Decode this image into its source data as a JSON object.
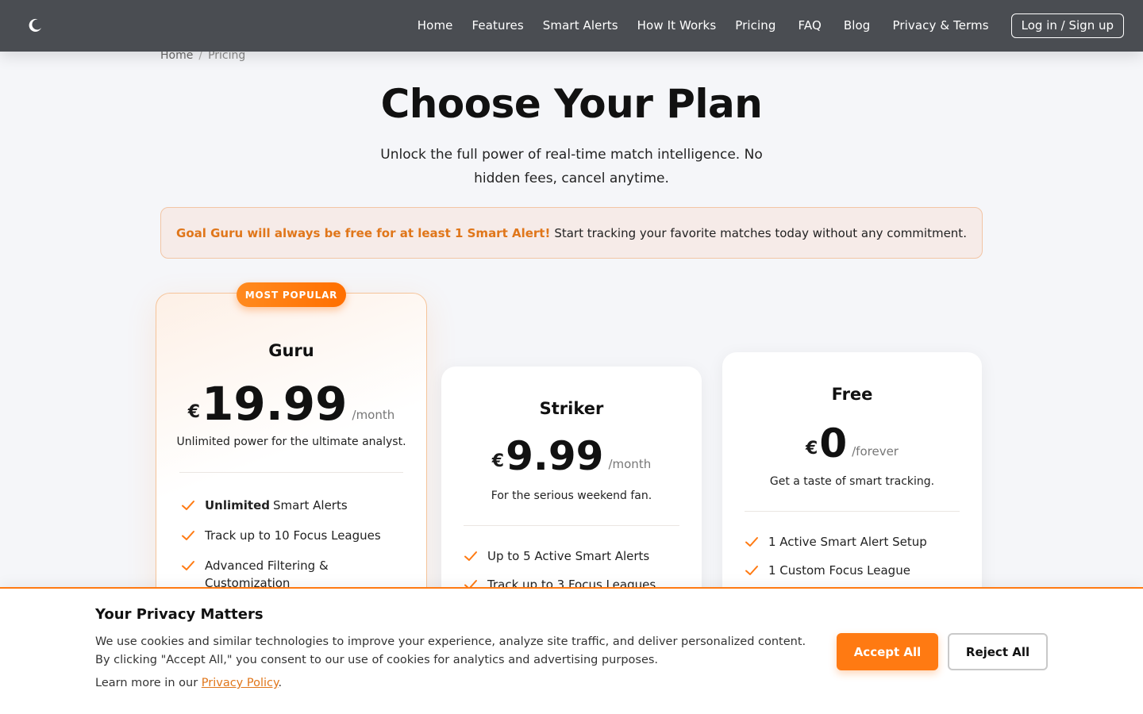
{
  "header": {
    "theme_icon": "moon-icon",
    "nav": [
      "Home",
      "Features",
      "Smart Alerts",
      "How It Works",
      "Pricing",
      "FAQ",
      "Blog",
      "Privacy & Terms"
    ],
    "login_label": "Log in / Sign up"
  },
  "breadcrumb": {
    "home": "Home",
    "separator": "/",
    "current": "Pricing"
  },
  "hero": {
    "title": "Choose Your Plan",
    "subtitle": "Unlock the full power of real-time match intelligence. No hidden fees, cancel anytime."
  },
  "banner": {
    "highlight": "Goal Guru will always be free for at least 1 Smart Alert!",
    "text": "Start tracking your favorite matches today without any commitment."
  },
  "plans": [
    {
      "badge": "MOST POPULAR",
      "name": "Guru",
      "currency": "€",
      "price": "19.99",
      "period": "/month",
      "description": "Unlimited power for the ultimate analyst.",
      "features": [
        {
          "bold": "Unlimited",
          "text": "Smart Alerts"
        },
        {
          "bold": "",
          "text": "Track up to 10 Focus Leagues"
        },
        {
          "bold": "",
          "text": "Advanced Filtering & Customization"
        }
      ]
    },
    {
      "name": "Striker",
      "currency": "€",
      "price": "9.99",
      "period": "/month",
      "description": "For the serious weekend fan.",
      "features": [
        {
          "bold": "",
          "text": "Up to 5 Active Smart Alerts"
        },
        {
          "bold": "",
          "text": "Track up to 3 Focus Leagues"
        }
      ]
    },
    {
      "name": "Free",
      "currency": "€",
      "price": "0",
      "period": "/forever",
      "description": "Get a taste of smart tracking.",
      "features": [
        {
          "bold": "",
          "text": "1 Active Smart Alert Setup"
        },
        {
          "bold": "",
          "text": "1 Custom Focus League"
        }
      ]
    }
  ],
  "cookie": {
    "title": "Your Privacy Matters",
    "text": "We use cookies and similar technologies to improve your experience, analyze site traffic, and deliver personalized content. By clicking \"Accept All,\" you consent to our use of cookies for analytics and advertising purposes.",
    "learn_prefix": "Learn more in our",
    "link": "Privacy Policy",
    "learn_suffix": ".",
    "accept": "Accept All",
    "reject": "Reject All"
  },
  "colors": {
    "accent": "#ff7a12",
    "nav_bg": "#4a4d52",
    "highlight_text": "#e0761a"
  }
}
